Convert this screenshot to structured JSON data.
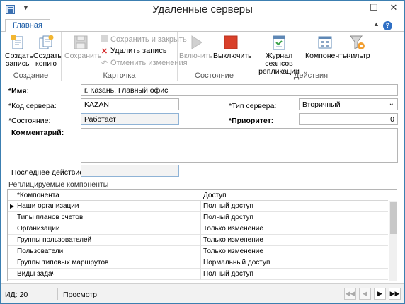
{
  "window": {
    "title": "Удаленные серверы"
  },
  "ribbon": {
    "tab": "Главная",
    "groups": {
      "create": {
        "label": "Создание",
        "new_record": "Создать запись",
        "copy": "Создать копию"
      },
      "card": {
        "label": "Карточка",
        "save": "Сохранить",
        "save_close": "Сохранить и закрыть",
        "delete": "Удалить запись",
        "cancel": "Отменить изменения"
      },
      "state": {
        "label": "Состояние",
        "enable": "Включить",
        "disable": "Выключить"
      },
      "actions": {
        "label": "Действия",
        "journal": "Журнал сеансов репликации",
        "components": "Компоненты",
        "filter": "Фильтр"
      }
    }
  },
  "form": {
    "name_label": "*Имя:",
    "name_value": "г. Казань. Главный офис",
    "code_label": "*Код сервера:",
    "code_value": "KAZAN",
    "type_label": "*Тип сервера:",
    "type_value": "Вторичный",
    "state_label": "*Состояние:",
    "state_value": "Работает",
    "priority_label": "*Приоритет:",
    "priority_value": "0",
    "comment_label": "Комментарий:",
    "comment_value": "",
    "last_action_label": "Последнее действие:",
    "last_action_value": ""
  },
  "components": {
    "section_title": "Реплицируемые компоненты",
    "columns": [
      "*Компонента",
      "Доступ"
    ],
    "rows": [
      [
        "Наши организации",
        "Полный доступ"
      ],
      [
        "Типы планов счетов",
        "Полный доступ"
      ],
      [
        "Организации",
        "Только изменение"
      ],
      [
        "Группы пользователей",
        "Только изменение"
      ],
      [
        "Пользователи",
        "Только изменение"
      ],
      [
        "Группы типовых маршрутов",
        "Нормальный доступ"
      ],
      [
        "Виды задач",
        "Полный доступ"
      ]
    ]
  },
  "status": {
    "id": "ИД: 20",
    "mode": "Просмотр"
  },
  "colors": {
    "accent": "#1f5fa8",
    "disable_red": "#d9402a",
    "delete_red": "#d42a2a"
  },
  "icons": {
    "new_record": "new-record-icon",
    "copy": "copy-record-icon",
    "save": "save-icon",
    "delete": "delete-x-icon",
    "enable": "play-icon",
    "disable": "stop-icon",
    "journal": "journal-icon",
    "components": "components-icon",
    "filter": "filter-icon"
  }
}
